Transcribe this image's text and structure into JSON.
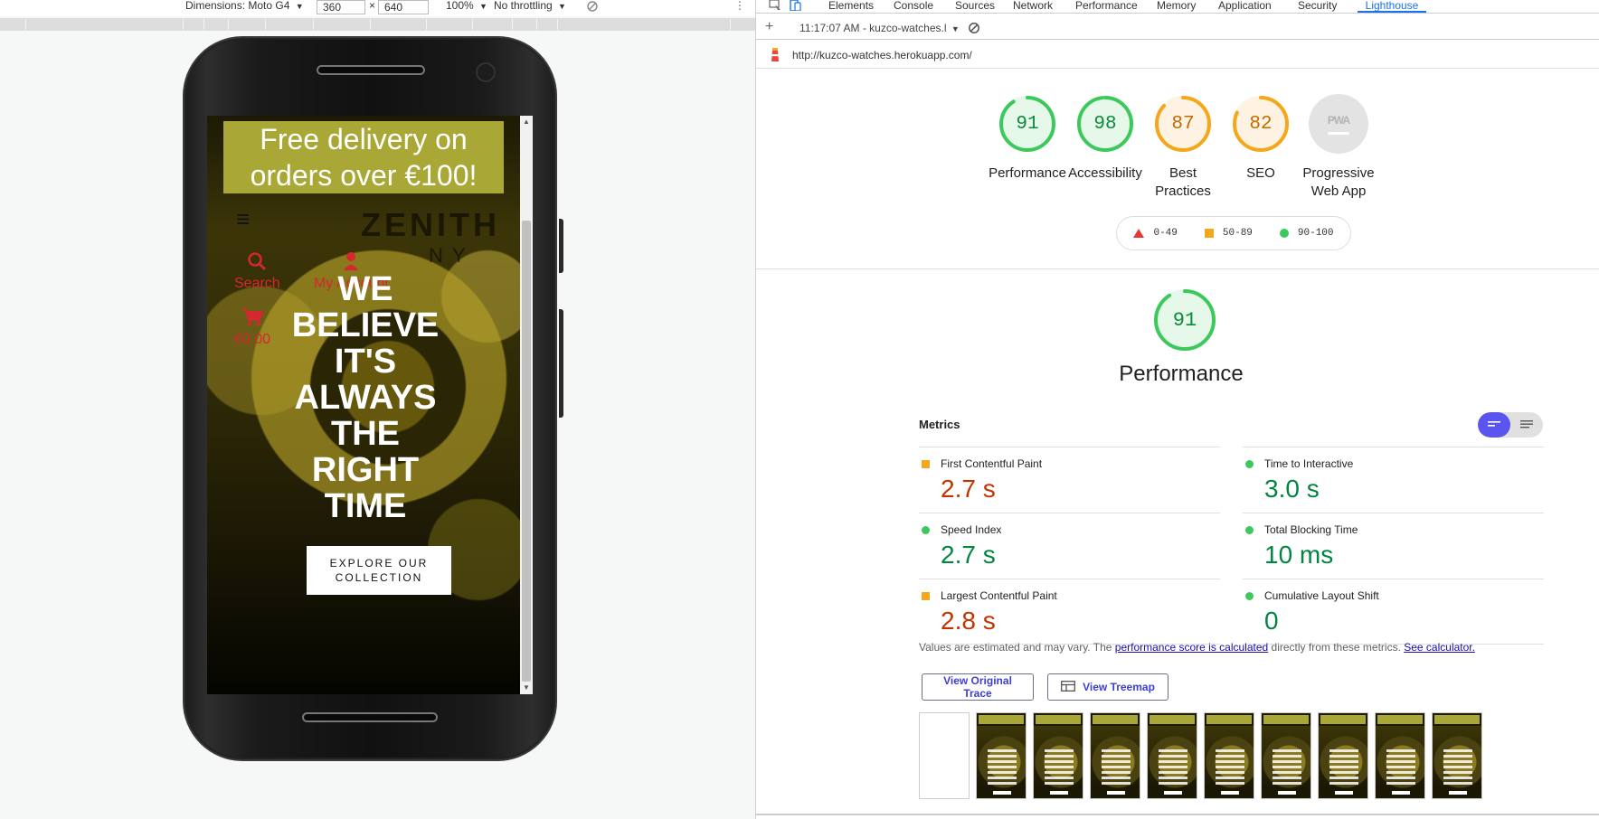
{
  "device_toolbar": {
    "dimensions_label": "Dimensions: Moto G4",
    "width": "360",
    "height": "640",
    "times": "×",
    "zoom": "100%",
    "throttling": "No throttling",
    "more_icon": "⋮",
    "dropdown_arrow": "▼"
  },
  "site": {
    "promo": "Free delivery on orders over €100!",
    "menu_icon": "≡",
    "search_icon": "🔍",
    "search_label": "Search",
    "account_icon": "👤",
    "account_label": "My Account",
    "cart_icon": "🛒",
    "cart_total": "€0.00",
    "hero_title": "WE BELIEVE IT'S ALWAYS THE RIGHT TIME",
    "cta": "EXPLORE OUR COLLECTION"
  },
  "devtools": {
    "tabs": [
      "Elements",
      "Console",
      "Sources",
      "Network",
      "Performance",
      "Memory",
      "Application",
      "Security",
      "Lighthouse"
    ],
    "active_tab": "Lighthouse",
    "report_selector": "11:17:07 AM - kuzco-watches.l",
    "url": "http://kuzco-watches.herokuapp.com/"
  },
  "lighthouse": {
    "categories": [
      {
        "label": "Performance",
        "score": "91",
        "status": "pass"
      },
      {
        "label": "Accessibility",
        "score": "98",
        "status": "pass"
      },
      {
        "label": "Best Practices",
        "score": "87",
        "status": "average"
      },
      {
        "label": "SEO",
        "score": "82",
        "status": "average"
      },
      {
        "label": "Progressive Web App",
        "score": "",
        "status": "na"
      }
    ],
    "pwa_badge": "PWA",
    "legend": [
      {
        "range": "0-49",
        "shape": "triangle",
        "color": "#e53935"
      },
      {
        "range": "50-89",
        "shape": "square",
        "color": "#f4a71a"
      },
      {
        "range": "90-100",
        "shape": "circle",
        "color": "#3cc95b"
      }
    ],
    "perf_score": "91",
    "perf_title": "Performance",
    "metrics_title": "Metrics",
    "metrics_left": [
      {
        "name": "First Contentful Paint",
        "value": "2.7 s",
        "status": "average"
      },
      {
        "name": "Speed Index",
        "value": "2.7 s",
        "status": "pass"
      },
      {
        "name": "Largest Contentful Paint",
        "value": "2.8 s",
        "status": "average"
      }
    ],
    "metrics_right": [
      {
        "name": "Time to Interactive",
        "value": "3.0 s",
        "status": "pass"
      },
      {
        "name": "Total Blocking Time",
        "value": "10 ms",
        "status": "pass"
      },
      {
        "name": "Cumulative Layout Shift",
        "value": "0",
        "status": "pass"
      }
    ],
    "disclaimer_pre": "Values are estimated and may vary. The ",
    "disclaimer_link1": "performance score is calculated",
    "disclaimer_mid": " directly from these metrics. ",
    "disclaimer_link2": "See calculator.",
    "btn_trace": "View Original Trace",
    "btn_treemap": "View Treemap",
    "colors": {
      "pass": "#3cc95b",
      "average": "#f4a71a",
      "fail": "#e53935",
      "accent": "#1a73e8"
    }
  }
}
